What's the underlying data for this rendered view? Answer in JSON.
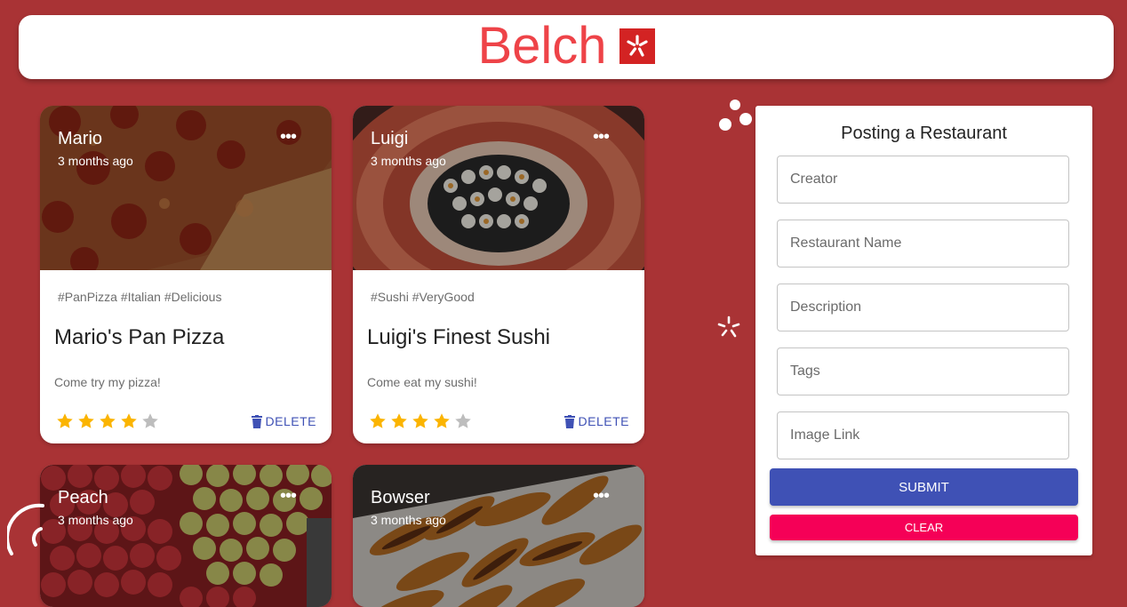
{
  "brand": {
    "name": "Belch",
    "logo_icon": "yelp-burst-icon"
  },
  "posts": [
    {
      "creator": "Mario",
      "time": "3 months ago",
      "tags": "#PanPizza #Italian #Delicious",
      "title": "Mario's Pan Pizza",
      "description": "Come try my pizza!",
      "rating": 4,
      "max_rating": 5,
      "delete_label": "DELETE",
      "image": "pizza"
    },
    {
      "creator": "Luigi",
      "time": "3 months ago",
      "tags": "#Sushi #VeryGood",
      "title": "Luigi's Finest Sushi",
      "description": "Come eat my sushi!",
      "rating": 4,
      "max_rating": 5,
      "delete_label": "DELETE",
      "image": "sushi"
    },
    {
      "creator": "Peach",
      "time": "3 months ago",
      "image": "apples"
    },
    {
      "creator": "Bowser",
      "time": "3 months ago",
      "image": "potatoes"
    }
  ],
  "form": {
    "title": "Posting a Restaurant",
    "fields": {
      "creator": "Creator",
      "name": "Restaurant Name",
      "description": "Description",
      "tags": "Tags",
      "image": "Image Link"
    },
    "submit_label": "SUBMIT",
    "clear_label": "CLEAR"
  },
  "colors": {
    "background": "#a93335",
    "brand": "#ee4348",
    "primary": "#3f51b5",
    "secondary": "#f50057",
    "star": "#fbb400",
    "star_empty": "#bdbdbd"
  }
}
